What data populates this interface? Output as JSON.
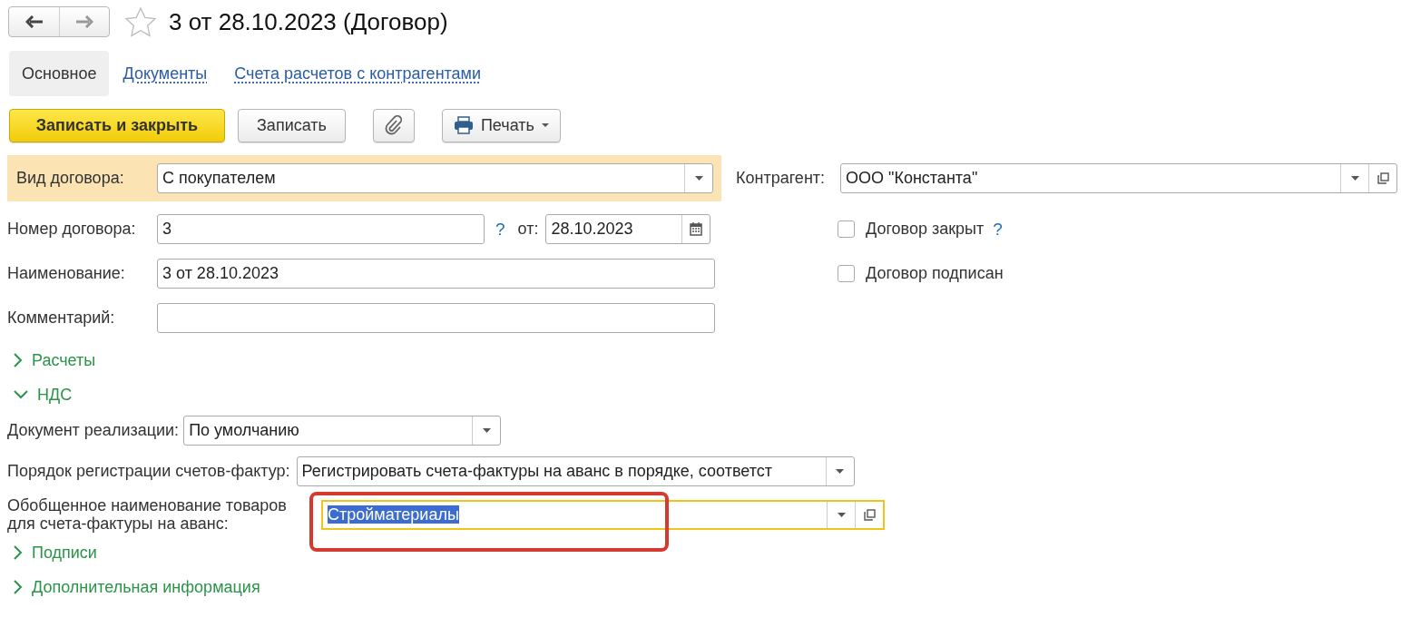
{
  "window": {
    "title": "3 от 28.10.2023 (Договор)",
    "favorite": false
  },
  "tabs": [
    {
      "label": "Основное",
      "selected": true
    },
    {
      "label": "Документы",
      "selected": false
    },
    {
      "label": "Счета расчетов с контрагентами",
      "selected": false
    }
  ],
  "toolbar": [
    {
      "kind": "primary",
      "label": "Записать и закрыть"
    },
    {
      "kind": "normal",
      "label": "Записать"
    },
    {
      "kind": "attach"
    },
    {
      "kind": "print",
      "label": "Печать"
    }
  ],
  "contract_type": {
    "label": "Вид договора:",
    "value": "С покупателем",
    "highlighted": true
  },
  "counterparty": {
    "label": "Контрагент:",
    "value": "ООО \"Константа\""
  },
  "number": {
    "label": "Номер договора:",
    "value": "3",
    "help": "?"
  },
  "date": {
    "label": "от:",
    "value": "28.10.2023"
  },
  "name": {
    "label": "Наименование:",
    "value": "3 от 28.10.2023"
  },
  "comment": {
    "label": "Комментарий:"
  },
  "checkboxes": [
    {
      "label": "Договор закрыт",
      "checked": false,
      "help": "?"
    },
    {
      "label": "Договор подписан",
      "checked": false
    }
  ],
  "sections": [
    {
      "label": "Расчеты",
      "expanded": false
    },
    {
      "label": "НДС",
      "expanded": true,
      "fields": [
        {
          "label": "Документ реализации:",
          "value": "По умолчанию",
          "kind": "short"
        },
        {
          "label": "Порядок регистрации счетов-фактур:",
          "value": "Регистрировать счета-фактуры на аванс в порядке, соответст",
          "kind": "long"
        },
        {
          "label": "Обобщенное наименование товаров для счета-фактуры на аванс:",
          "value": "Стройматериалы",
          "kind": "open",
          "focused": true,
          "text_selected": true,
          "annotated": true
        }
      ]
    },
    {
      "label": "Подписи",
      "expanded": false
    },
    {
      "label": "Дополнительная информация",
      "expanded": false
    }
  ]
}
